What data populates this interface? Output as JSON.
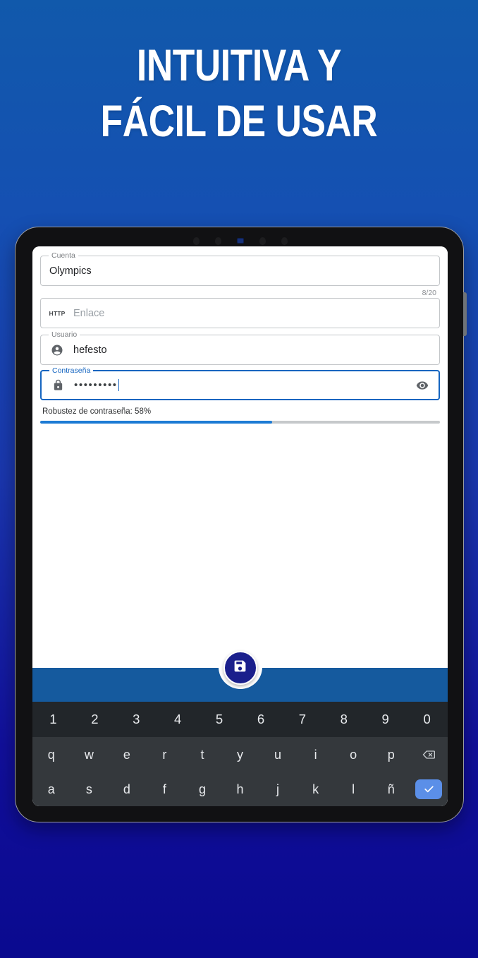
{
  "headline": {
    "line1": "INTUITIVA Y",
    "line2": "FÁCIL DE USAR"
  },
  "colors": {
    "bg_top": "#1159ab",
    "bg_bottom": "#0a0a8f",
    "accent": "#1565c0",
    "bottom_bar": "#155a9e",
    "fab": "#1a1f8c",
    "progress_fill": "#1d7bd4",
    "progress_track": "#c6c9cb",
    "keyboard_bg": "#34383c",
    "keyboard_num_bg": "#22262a",
    "enter_key": "#5b8fe8"
  },
  "form": {
    "account": {
      "label": "Cuenta",
      "value": "Olympics",
      "counter": "8/20"
    },
    "link": {
      "icon_label": "HTTP",
      "placeholder": "Enlace",
      "value": ""
    },
    "user": {
      "label": "Usuario",
      "value": "hefesto",
      "icon": "account-circle-icon"
    },
    "password": {
      "label": "Contraseña",
      "value": "•••••••••",
      "icon": "lock-icon",
      "toggle_icon": "eye-icon",
      "focused": true
    },
    "strength": {
      "label": "Robustez de contraseña: 58%",
      "percent": 58
    }
  },
  "fab": {
    "icon": "save-icon",
    "label": "Guardar"
  },
  "keyboard": {
    "row_numbers": [
      "1",
      "2",
      "3",
      "4",
      "5",
      "6",
      "7",
      "8",
      "9",
      "0"
    ],
    "row_top": [
      "q",
      "w",
      "e",
      "r",
      "t",
      "y",
      "u",
      "i",
      "o",
      "p"
    ],
    "row_home": [
      "a",
      "s",
      "d",
      "f",
      "g",
      "h",
      "j",
      "k",
      "l",
      "ñ"
    ],
    "backspace_icon": "backspace-icon",
    "enter_icon": "check-icon"
  }
}
